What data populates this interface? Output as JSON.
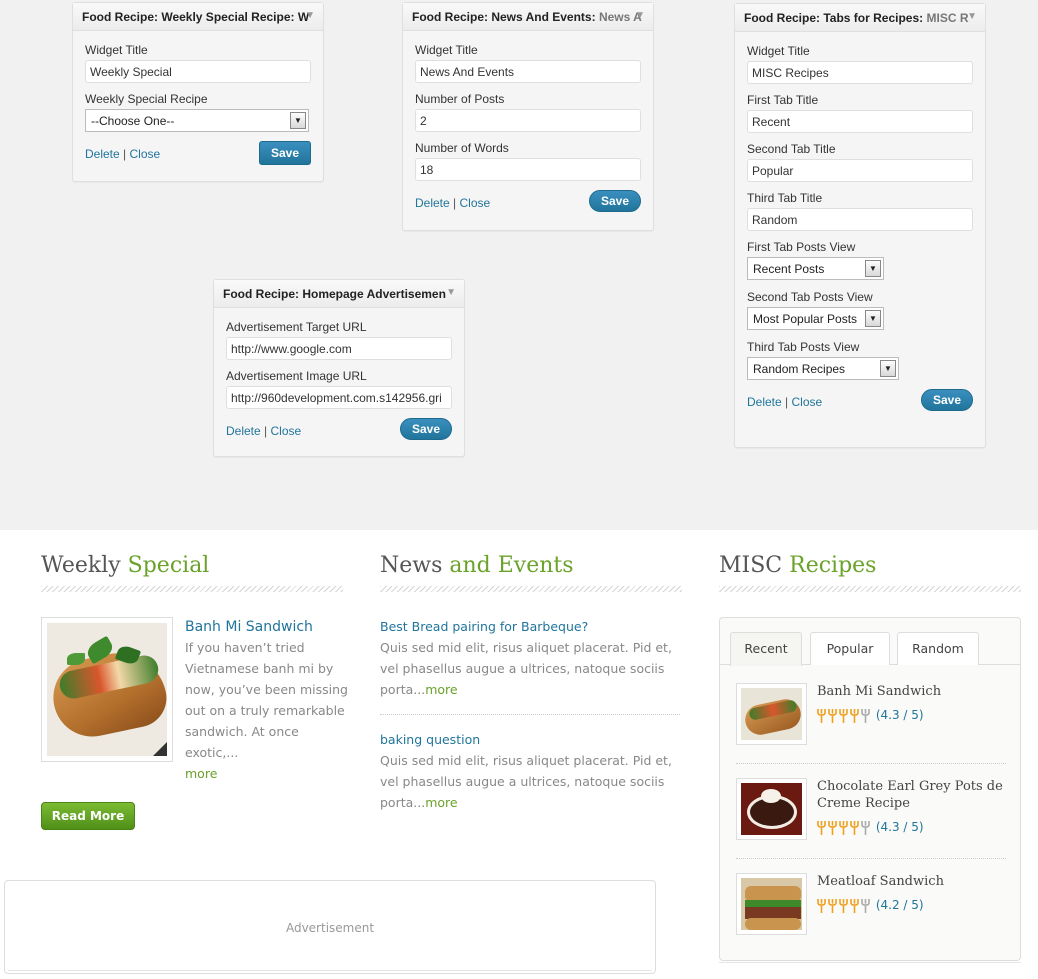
{
  "admin": {
    "weekly_widget": {
      "header_title": "Food Recipe: Weekly Special Recipe: W",
      "widget_title_label": "Widget Title",
      "widget_title_value": "Weekly Special",
      "recipe_label": "Weekly Special Recipe",
      "recipe_selected": "--Choose One--",
      "delete_label": "Delete",
      "separator": "|",
      "close_label": "Close",
      "save_label": "Save"
    },
    "news_widget": {
      "header_title": "Food Recipe: News And Events:",
      "header_sub": "News A",
      "widget_title_label": "Widget Title",
      "widget_title_value": "News And Events",
      "posts_label": "Number of Posts",
      "posts_value": "2",
      "words_label": "Number of Words",
      "words_value": "18",
      "delete_label": "Delete",
      "separator": "|",
      "close_label": "Close",
      "save_label": "Save"
    },
    "tabs_widget": {
      "header_title": "Food Recipe: Tabs for Recipes:",
      "header_sub": "MISC R",
      "widget_title_label": "Widget Title",
      "widget_title_value": "MISC Recipes",
      "first_tab_label": "First Tab Title",
      "first_tab_value": "Recent",
      "second_tab_label": "Second Tab Title",
      "second_tab_value": "Popular",
      "third_tab_label": "Third Tab Title",
      "third_tab_value": "Random",
      "first_view_label": "First Tab Posts View",
      "first_view_selected": "Recent Posts",
      "second_view_label": "Second Tab Posts View",
      "second_view_selected": "Most Popular Posts",
      "third_view_label": "Third Tab Posts View",
      "third_view_selected": "Random Recipes",
      "delete_label": "Delete",
      "separator": "|",
      "close_label": "Close",
      "save_label": "Save"
    },
    "ad_widget": {
      "header_title": "Food Recipe: Homepage Advertisemen",
      "target_label": "Advertisement Target URL",
      "target_value": "http://www.google.com",
      "image_label": "Advertisement Image URL",
      "image_value": "http://960development.com.s142956.gri",
      "delete_label": "Delete",
      "separator": "|",
      "close_label": "Close",
      "save_label": "Save"
    }
  },
  "front": {
    "weekly": {
      "title_plain": "Weekly",
      "title_accent": "Special",
      "post_title": "Banh Mi Sandwich",
      "excerpt": "If you haven’t tried Vietnamese banh mi by now, you’ve been missing out on a truly remarkable sandwich. At once exotic,...",
      "more": "more",
      "read_more": "Read More"
    },
    "news": {
      "title_plain": "News",
      "title_accent": "and Events",
      "items": [
        {
          "title": "Best Bread pairing for Barbeque?",
          "excerpt": "Quis sed mid elit, risus aliquet placerat. Pid et, vel phasellus augue a ultrices, natoque sociis porta...",
          "more": "more"
        },
        {
          "title": "baking question",
          "excerpt": "Quis sed mid elit, risus aliquet placerat. Pid et, vel phasellus augue a ultrices, natoque sociis porta...",
          "more": "more"
        }
      ]
    },
    "misc": {
      "title_plain": "MISC",
      "title_accent": "Recipes",
      "tabs": [
        "Recent",
        "Popular",
        "Random"
      ],
      "posts": [
        {
          "title": "Banh Mi Sandwich",
          "rating": "(4.3 / 5)",
          "rating_value": 4.3
        },
        {
          "title": "Chocolate Earl Grey Pots de Creme Recipe",
          "rating": "(4.3 / 5)",
          "rating_value": 4.3
        },
        {
          "title": "Meatloaf Sandwich",
          "rating": "(4.2 / 5)",
          "rating_value": 4.2
        }
      ]
    },
    "advertisement": {
      "label": "Advertisement"
    },
    "colors": {
      "accent_green": "#6aa22a",
      "link_blue": "#21759b",
      "rating_orange": "#f0a020"
    }
  }
}
